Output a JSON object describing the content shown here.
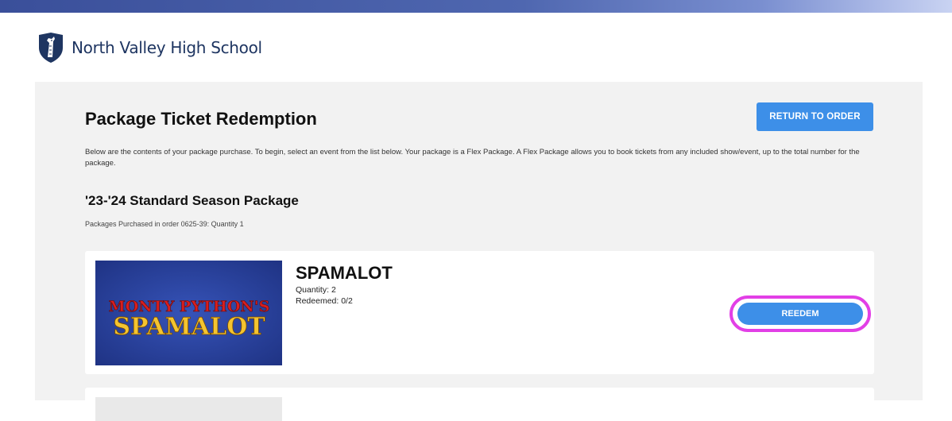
{
  "header": {
    "school_name": "North Valley High School",
    "logo_icon": "shield-giraffe-icon",
    "brand_color": "#1e3561"
  },
  "page": {
    "title": "Package Ticket Redemption",
    "return_button_label": "RETURN TO ORDER",
    "description": "Below are the contents of your package purchase. To begin, select an event from the list below. Your package is a Flex Package. A Flex Package allows you to book tickets from any included show/event, up to the total number for the package."
  },
  "package": {
    "title": "'23-'24 Standard Season Package",
    "subtitle": "Packages Purchased in order 0625-39: Quantity 1"
  },
  "events": [
    {
      "title": "SPAMALOT",
      "quantity": "Quantity: 2",
      "redeemed": "Redeemed: 0/2",
      "image_top_text": "MONTY PYTHON'S",
      "image_bottom_text": "SPAMALOT",
      "redeem_label": "REEDEM"
    }
  ],
  "colors": {
    "accent": "#3d8fe8",
    "highlight": "#e23fe6",
    "panel_bg": "#f2f2f2"
  }
}
